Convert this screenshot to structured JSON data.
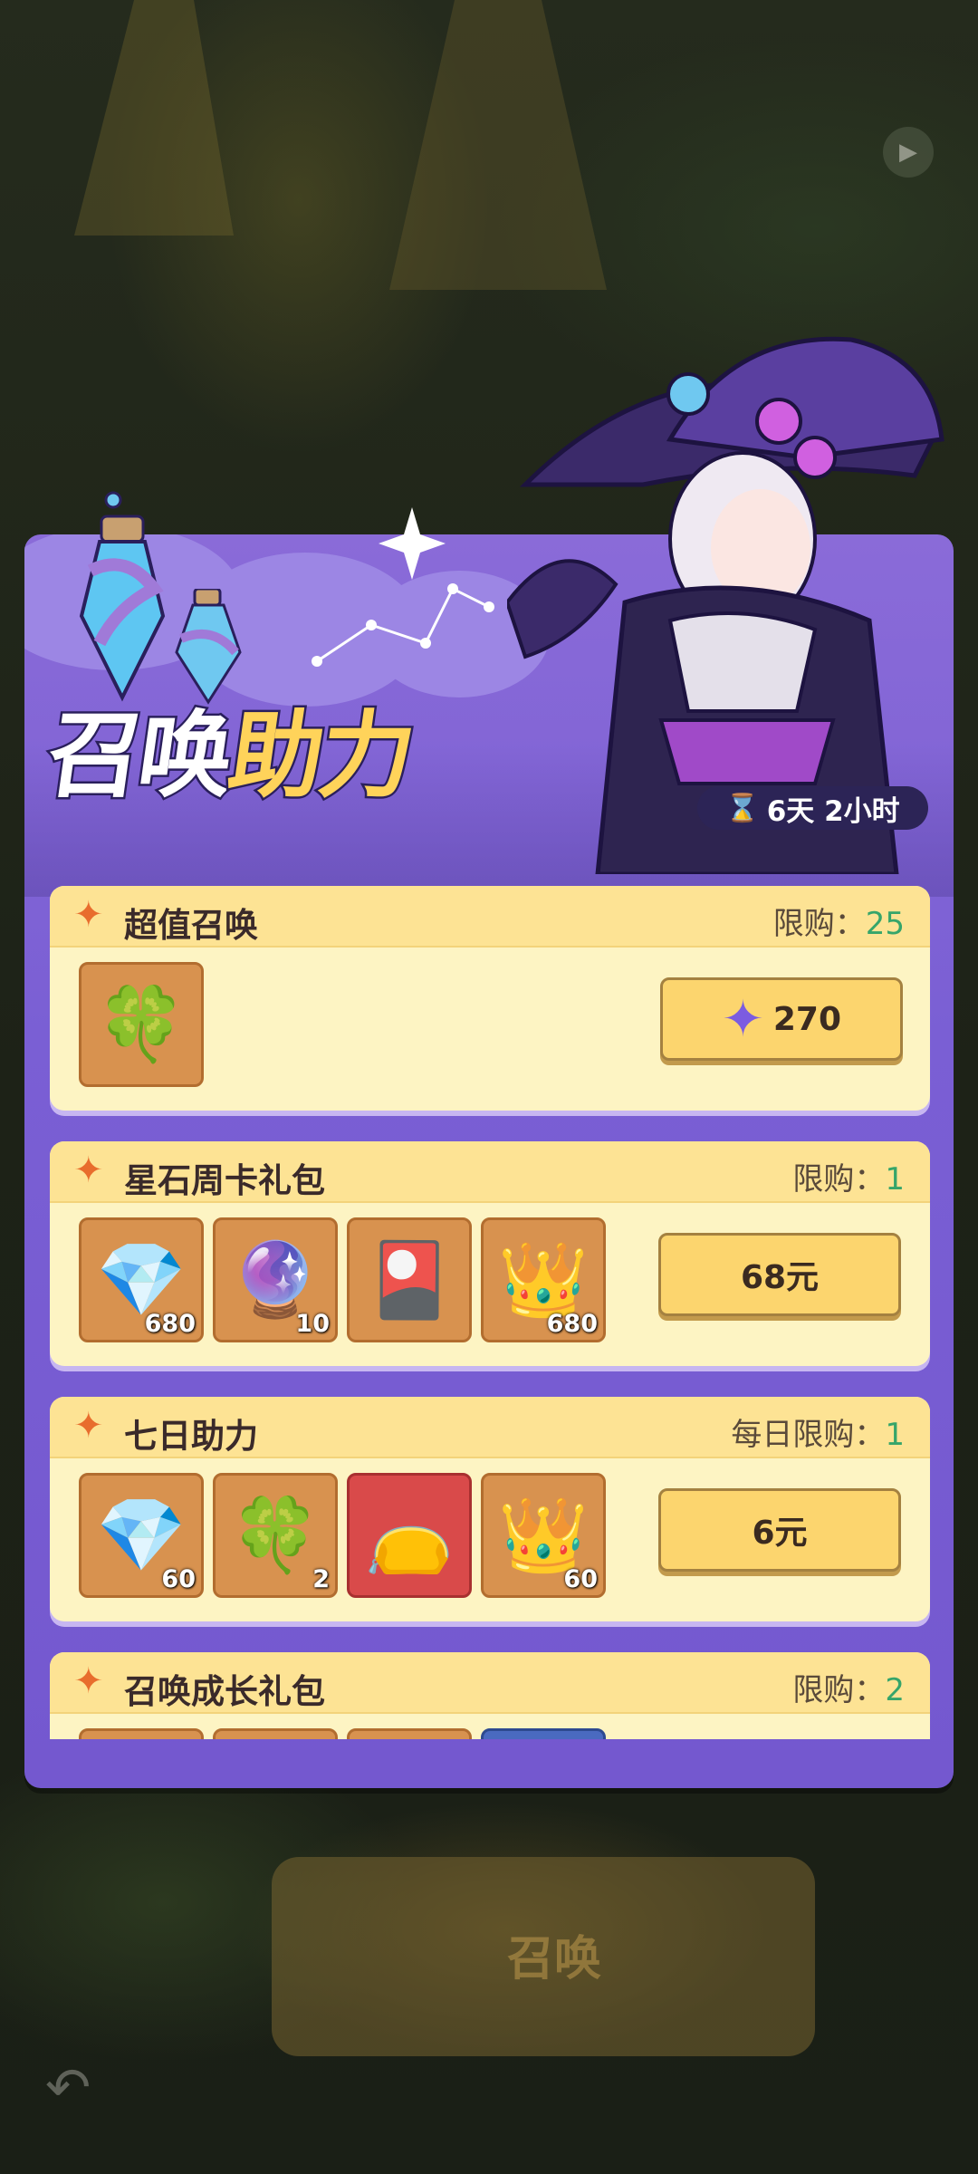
{
  "event": {
    "title_a": "召唤",
    "title_b": "助力",
    "timer": "6天 2小时"
  },
  "packs": [
    {
      "title": "超值召唤",
      "limit_label": "限购：",
      "limit_value": "25",
      "items": [
        {
          "icon": "four-leaf-clover-icon",
          "glyph": "🍀",
          "qty": ""
        }
      ],
      "price": "270",
      "price_icon": "star-gem-icon"
    },
    {
      "title": "星石周卡礼包",
      "limit_label": "限购：",
      "limit_value": "1",
      "items": [
        {
          "icon": "star-gem-icon",
          "glyph": "💎",
          "qty": "680"
        },
        {
          "icon": "summon-orb-icon",
          "glyph": "🔮",
          "qty": "10"
        },
        {
          "icon": "card-icon",
          "glyph": "🎴",
          "qty": ""
        },
        {
          "icon": "crown-icon",
          "glyph": "👑",
          "qty": "680"
        }
      ],
      "price": "68元"
    },
    {
      "title": "七日助力",
      "limit_label": "每日限购：",
      "limit_value": "1",
      "items": [
        {
          "icon": "star-gem-icon",
          "glyph": "💎",
          "qty": "60"
        },
        {
          "icon": "four-leaf-clover-icon",
          "glyph": "🍀",
          "qty": "2"
        },
        {
          "icon": "treasure-bag-icon",
          "glyph": "👝",
          "qty": ""
        },
        {
          "icon": "crown-icon",
          "glyph": "👑",
          "qty": "60"
        }
      ],
      "price": "6元"
    },
    {
      "title": "召唤成长礼包",
      "limit_label": "限购：",
      "limit_value": "2"
    }
  ],
  "background": {
    "summon_button_text": "召唤"
  }
}
